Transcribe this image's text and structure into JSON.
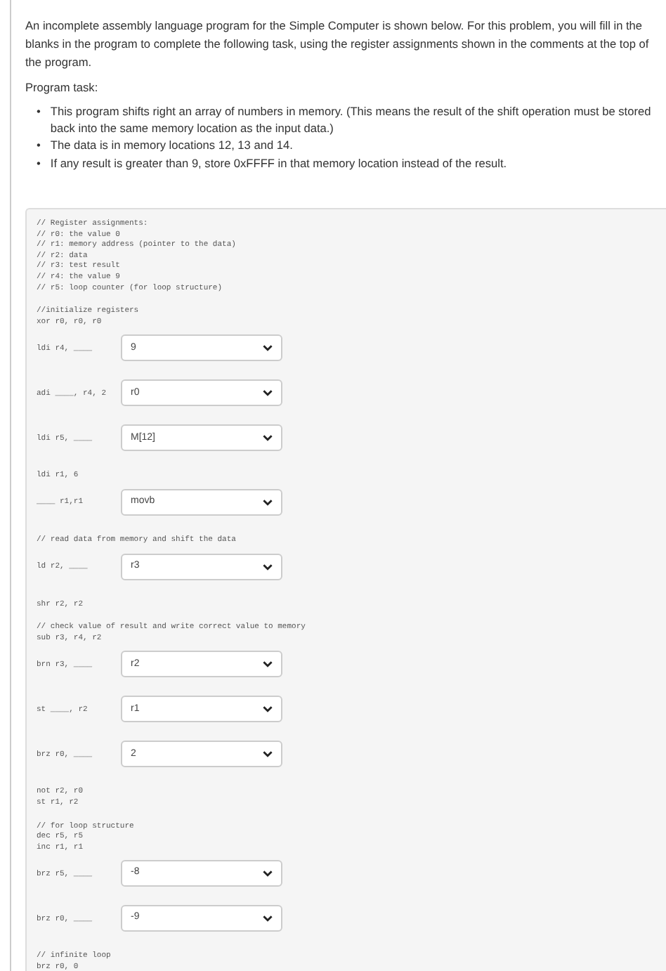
{
  "intro": "An incomplete assembly language program for the Simple Computer is shown below. For this problem, you will fill in the blanks in the program to complete the following task, using the register assignments shown in the comments at the top of the program.",
  "task_label": "Program task:",
  "task_items": [
    {
      "bullet": "•",
      "text": "This program shifts right an array of numbers in memory. (This means the result of the shift operation must be stored back into the same memory location as the input data.)"
    },
    {
      "bullet": "•",
      "text": "The data is in memory locations 12, 13 and 14."
    },
    {
      "bullet": "•",
      "text": "If any result is greater than 9, store 0xFFFF in that memory location instead of the result."
    }
  ],
  "code_blocks": [
    [
      {
        "kind": "code",
        "text": "// Register assignments:"
      },
      {
        "kind": "code",
        "text": "// r0: the value 0"
      },
      {
        "kind": "code",
        "text": "// r1: memory address (pointer to the data)"
      },
      {
        "kind": "code",
        "text": "// r2: data"
      },
      {
        "kind": "code",
        "text": "// r3: test result"
      },
      {
        "kind": "code",
        "text": "// r4: the value 9"
      },
      {
        "kind": "code",
        "text": "// r5: loop counter (for loop structure)"
      }
    ],
    [
      {
        "kind": "code",
        "text": "//initialize registers"
      },
      {
        "kind": "code",
        "text": "xor r0, r0, r0"
      },
      {
        "kind": "select",
        "text": "ldi r4, ____",
        "value": "9"
      },
      {
        "kind": "select",
        "text": "adi ____, r4, 2",
        "value": "r0"
      },
      {
        "kind": "select",
        "text": "ldi r5, ____",
        "value": "M[12]"
      },
      {
        "kind": "code",
        "text": "ldi r1, 6"
      },
      {
        "kind": "select",
        "text": "____ r1,r1",
        "value": "movb"
      }
    ],
    [
      {
        "kind": "code",
        "text": "// read data from memory and shift the data"
      },
      {
        "kind": "select",
        "text": "ld r2, ____",
        "value": "r3"
      },
      {
        "kind": "code",
        "text": "shr r2, r2"
      }
    ],
    [
      {
        "kind": "code",
        "text": "// check value of result and write correct value to memory"
      },
      {
        "kind": "code",
        "text": "sub r3, r4, r2"
      },
      {
        "kind": "select",
        "text": "brn r3, ____",
        "value": "r2"
      },
      {
        "kind": "select",
        "text": "st ____, r2",
        "value": "r1"
      },
      {
        "kind": "select",
        "text": "brz r0, ____",
        "value": "2"
      },
      {
        "kind": "code",
        "text": "not r2, r0"
      },
      {
        "kind": "code",
        "text": "st r1, r2"
      }
    ],
    [
      {
        "kind": "code",
        "text": "// for loop structure"
      },
      {
        "kind": "code",
        "text": "dec r5, r5"
      },
      {
        "kind": "code",
        "text": "inc r1, r1"
      },
      {
        "kind": "select",
        "text": "brz r5, ____",
        "value": "-8"
      },
      {
        "kind": "select",
        "text": "brz r0, ____",
        "value": "-9"
      }
    ],
    [
      {
        "kind": "code",
        "text": "// infinite loop"
      },
      {
        "kind": "code",
        "text": "brz r0, 0"
      }
    ]
  ]
}
